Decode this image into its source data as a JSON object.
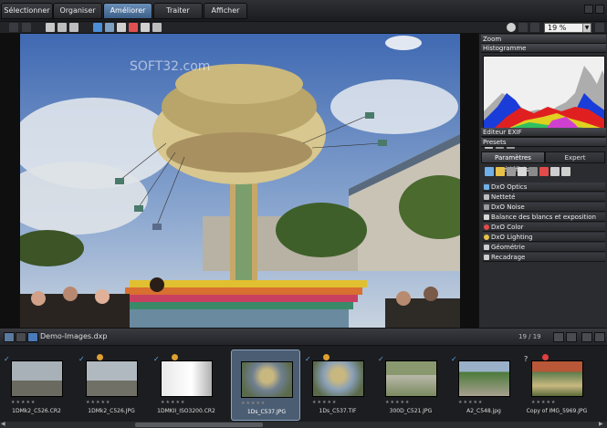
{
  "tabs": [
    {
      "label": "Sélectionner",
      "active": false
    },
    {
      "label": "Organiser",
      "active": false
    },
    {
      "label": "Améliorer",
      "active": true
    },
    {
      "label": "Traiter",
      "active": false
    },
    {
      "label": "Afficher",
      "active": false
    }
  ],
  "toolbar": {
    "zoom_value": "19 %"
  },
  "viewer": {
    "watermark": "SOFT32.com"
  },
  "palette": {
    "zoom_label": "Zoom",
    "histogram_label": "Histogramme",
    "exif_label": "Editeur EXIF",
    "presets_label": "Presets",
    "tab_presets": "Paramètres prédéfinis",
    "tab_expert": "Expert",
    "items": [
      {
        "label": "DxO Optics",
        "icon": "optics-icon",
        "color": "#6fb0e8"
      },
      {
        "label": "Netteté",
        "icon": "sharpness-icon",
        "color": "#bfbfbf"
      },
      {
        "label": "DxO Noise",
        "icon": "noise-icon",
        "color": "#9a9a9a"
      },
      {
        "label": "Balance des blancs et exposition",
        "icon": "balance-icon",
        "color": "#d8d8d8"
      },
      {
        "label": "DxO Color",
        "icon": "color-icon",
        "color": "#e24b4b"
      },
      {
        "label": "DxO Lighting",
        "icon": "lighting-icon",
        "color": "#e8c24a"
      },
      {
        "label": "Géométrie",
        "icon": "geometry-icon",
        "color": "#cfcfcf"
      },
      {
        "label": "Recadrage",
        "icon": "crop-icon",
        "color": "#cfcfcf"
      }
    ]
  },
  "filmstrip": {
    "project_name": "Demo-Images.dxp",
    "count": "19 / 19",
    "items": [
      {
        "caption": "1DMk2_C526.CR2",
        "selected": false,
        "warn": false
      },
      {
        "caption": "1DMk2_C526.JPG",
        "selected": false,
        "warn": true
      },
      {
        "caption": "1DMKII_ISO3200.CR2",
        "selected": false,
        "warn": true
      },
      {
        "caption": "1Ds_C537.JPG",
        "selected": true,
        "warn": false
      },
      {
        "caption": "1Ds_C537.TIF",
        "selected": false,
        "warn": true
      },
      {
        "caption": "300D_C521.JPG",
        "selected": false,
        "warn": false
      },
      {
        "caption": "A2_C548.jpg",
        "selected": false,
        "warn": false
      },
      {
        "caption": "Copy of IMG_5969.JPG",
        "selected": false,
        "warn": false
      }
    ]
  },
  "colors": {
    "accent": "#4b6f97",
    "selection": "#4b5d72"
  }
}
